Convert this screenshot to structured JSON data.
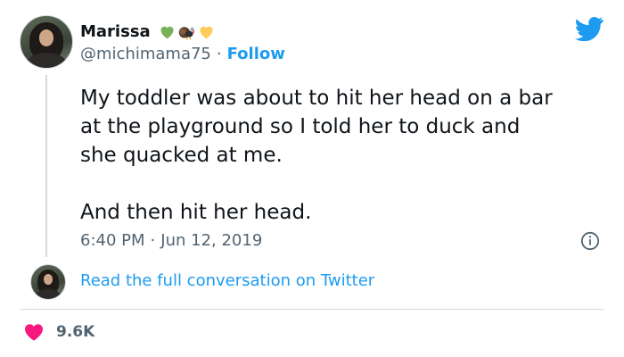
{
  "user": {
    "display_name": "Marissa",
    "handle": "@michimama75",
    "separator": "·",
    "follow_label": "Follow",
    "name_emojis": [
      "green-heart-emoji",
      "turkey-emoji",
      "yellow-heart-emoji"
    ]
  },
  "tweet": {
    "text": "My toddler was about to hit her head on a bar\nat the playground so I told her to duck and\nshe quacked at me.\n\nAnd then hit her head.",
    "time": "6:40 PM",
    "separator": "·",
    "date": "Jun 12, 2019"
  },
  "conversation": {
    "link_label": "Read the full conversation on Twitter"
  },
  "engagement": {
    "likes": "9.6K"
  },
  "icons": {
    "brand": "twitter-bird-icon",
    "info": "info-icon",
    "like": "heart-icon"
  },
  "colors": {
    "accent": "#1d9bf0",
    "heart": "#f91880",
    "text": "#0f1419",
    "muted": "#536471"
  }
}
